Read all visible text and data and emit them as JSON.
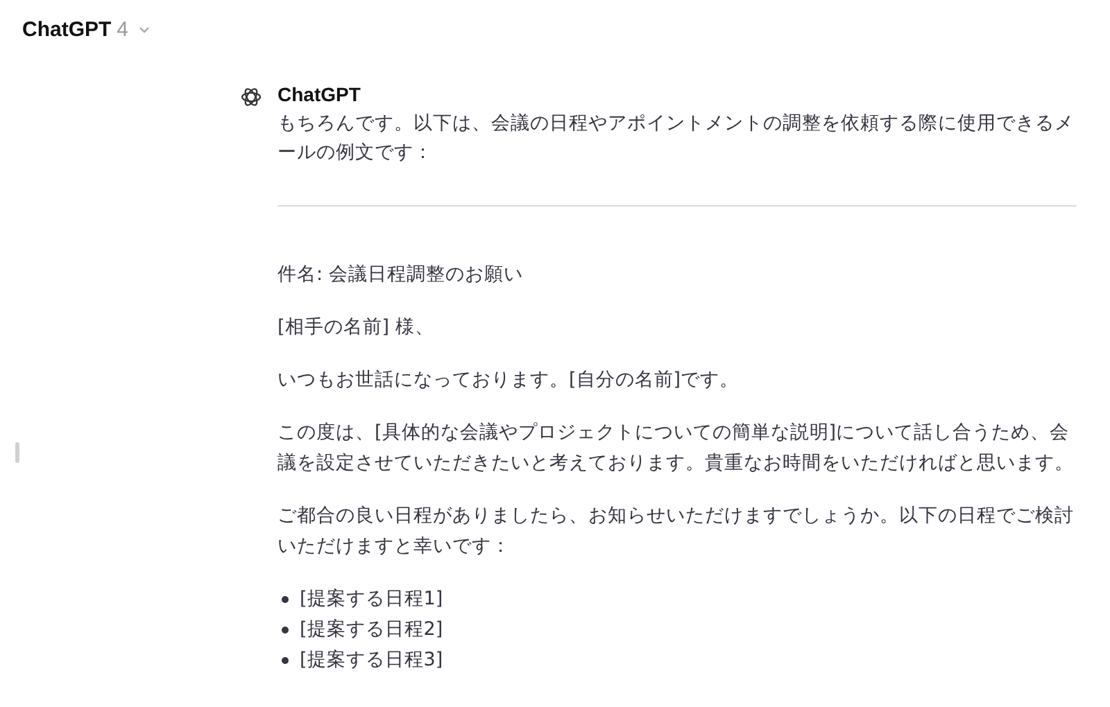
{
  "header": {
    "title": "ChatGPT",
    "version": "4"
  },
  "message": {
    "author": "ChatGPT",
    "intro": "もちろんです。以下は、会議の日程やアポイントメントの調整を依頼する際に使用できるメールの例文です：",
    "paragraphs": [
      "件名: 会議日程調整のお願い",
      "[相手の名前] 様、",
      "いつもお世話になっております。[自分の名前]です。",
      "この度は、[具体的な会議やプロジェクトについての簡単な説明]について話し合うため、会議を設定させていただきたいと考えております。貴重なお時間をいただければと思います。",
      "ご都合の良い日程がありましたら、お知らせいただけますでしょうか。以下の日程でご検討いただけますと幸いです："
    ],
    "list": [
      "[提案する日程1]",
      "[提案する日程2]",
      "[提案する日程3]"
    ]
  }
}
